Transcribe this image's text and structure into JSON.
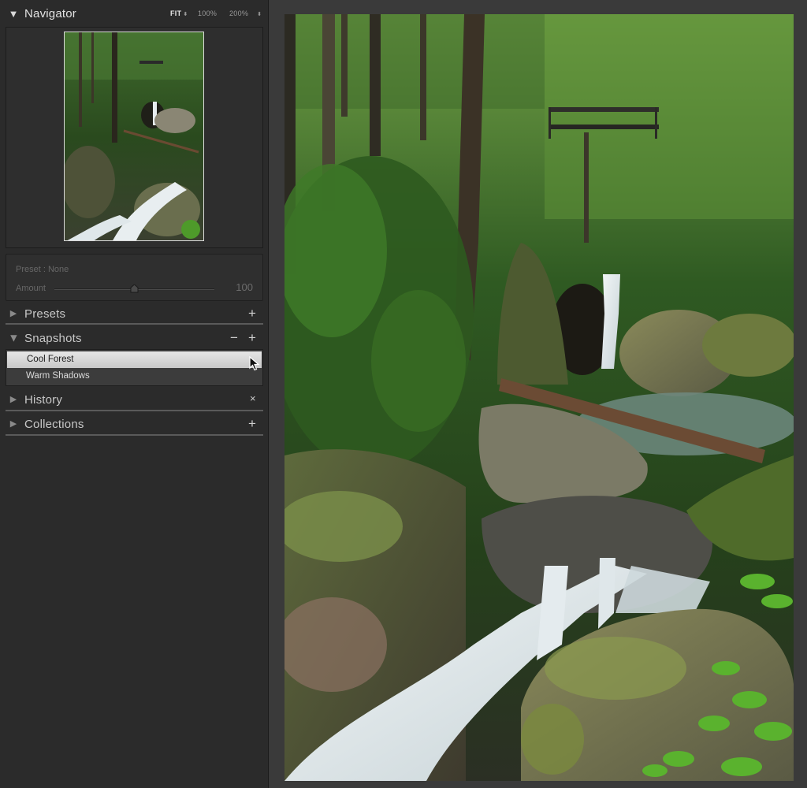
{
  "navigator": {
    "title": "Navigator",
    "zoom_options": {
      "fit": "FIT",
      "z100": "100%",
      "z200": "200%"
    }
  },
  "preset_amount": {
    "preset_label": "Preset : None",
    "amount_label": "Amount",
    "amount_value": "100",
    "amount_level_percent": 50
  },
  "panels": {
    "presets": {
      "title": "Presets",
      "action": "+"
    },
    "snapshots": {
      "title": "Snapshots",
      "remove_action": "−",
      "add_action": "+",
      "items": [
        {
          "label": "Cool Forest",
          "selected": true
        },
        {
          "label": "Warm Shadows",
          "selected": false
        }
      ]
    },
    "history": {
      "title": "History",
      "action": "×"
    },
    "collections": {
      "title": "Collections",
      "action": "+"
    }
  },
  "colors": {
    "panel_bg": "#2b2b2b",
    "window_bg": "#3a3a3a",
    "selected_row": "#d9d9d9"
  },
  "icons": {
    "collapse": "triangle-down-icon",
    "expand": "triangle-right-icon",
    "cursor": "pointer-cursor-icon"
  }
}
